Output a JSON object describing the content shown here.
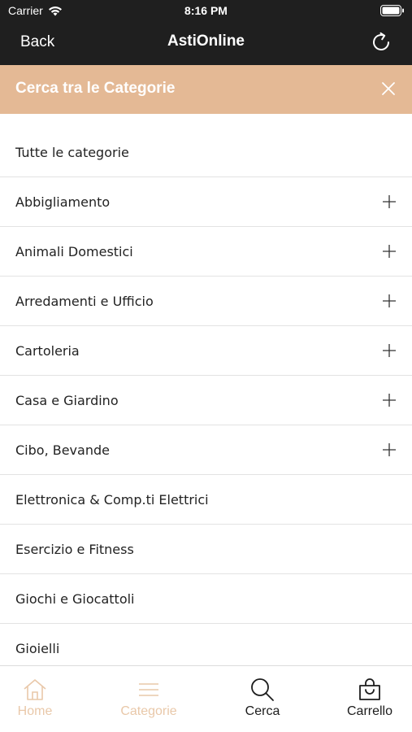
{
  "status_bar": {
    "carrier": "Carrier",
    "time": "8:16 PM"
  },
  "nav": {
    "back_label": "Back",
    "title": "AstiOnline",
    "refresh_icon": "refresh-icon"
  },
  "search_header": {
    "label": "Cerca tra le Categorie",
    "close_icon": "close-icon",
    "color": "#e4b995"
  },
  "categories": [
    {
      "label": "Tutte le categorie",
      "expandable": false
    },
    {
      "label": "Abbigliamento",
      "expandable": true
    },
    {
      "label": "Animali Domestici",
      "expandable": true
    },
    {
      "label": "Arredamenti e Ufficio",
      "expandable": true
    },
    {
      "label": "Cartoleria",
      "expandable": true
    },
    {
      "label": "Casa e Giardino",
      "expandable": true
    },
    {
      "label": "Cibo, Bevande",
      "expandable": true
    },
    {
      "label": "Elettronica & Comp.ti Elettrici",
      "expandable": false
    },
    {
      "label": "Esercizio e Fitness",
      "expandable": false
    },
    {
      "label": "Giochi e Giocattoli",
      "expandable": false
    },
    {
      "label": "Gioielli",
      "expandable": false
    }
  ],
  "tabs": [
    {
      "label": "Home",
      "icon": "home-icon",
      "active": false
    },
    {
      "label": "Categorie",
      "icon": "menu-icon",
      "active": false
    },
    {
      "label": "Cerca",
      "icon": "search-icon",
      "active": true
    },
    {
      "label": "Carrello",
      "icon": "cart-icon",
      "active": true
    }
  ],
  "colors": {
    "bar_background": "#1f1f1f",
    "accent": "#e4b995",
    "inactive_tab": "#e9c8a9"
  }
}
